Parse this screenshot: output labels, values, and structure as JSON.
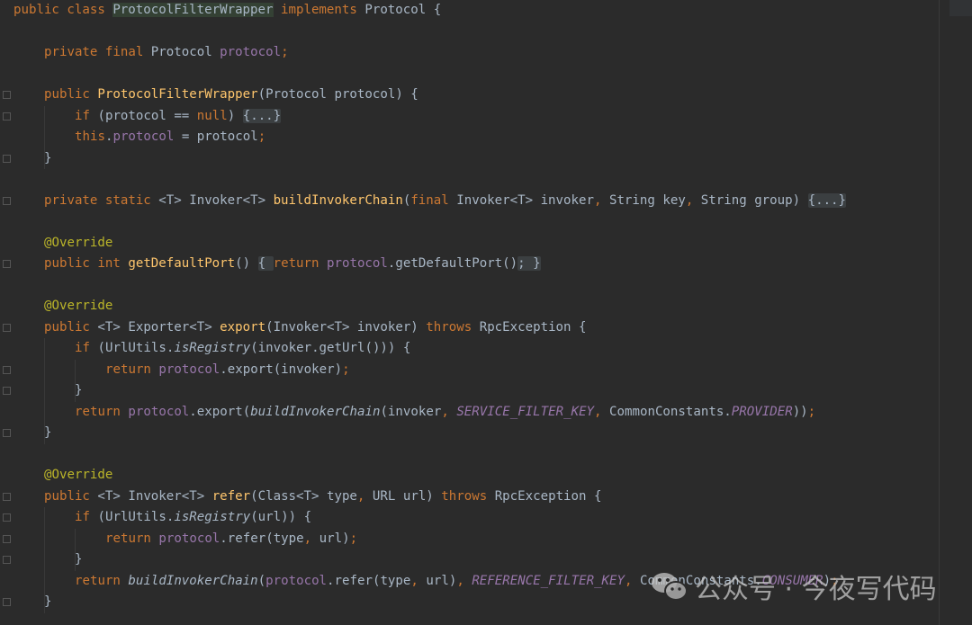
{
  "editor": {
    "lines": [
      {
        "indent": 0,
        "tokens": [
          [
            "k",
            "public class "
          ],
          [
            "hl",
            "ProtocolFilterWrapper"
          ],
          [
            "k",
            " implements "
          ],
          [
            "t",
            "Protocol {"
          ]
        ]
      },
      {
        "indent": 0,
        "tokens": []
      },
      {
        "indent": 4,
        "tokens": [
          [
            "k",
            "private final "
          ],
          [
            "t",
            "Protocol "
          ],
          [
            "f",
            "protocol"
          ],
          [
            "k",
            ";"
          ]
        ]
      },
      {
        "indent": 0,
        "tokens": []
      },
      {
        "indent": 4,
        "tokens": [
          [
            "k",
            "public "
          ],
          [
            "m",
            "ProtocolFilterWrapper"
          ],
          [
            "t",
            "(Protocol protocol) {"
          ]
        ]
      },
      {
        "indent": 8,
        "tokens": [
          [
            "k",
            "if "
          ],
          [
            "t",
            "(protocol == "
          ],
          [
            "k",
            "null"
          ],
          [
            "t",
            ") "
          ],
          [
            "fold",
            "{...}"
          ]
        ]
      },
      {
        "indent": 8,
        "tokens": [
          [
            "k",
            "this"
          ],
          [
            "t",
            "."
          ],
          [
            "f",
            "protocol"
          ],
          [
            "t",
            " = protocol"
          ],
          [
            "k",
            ";"
          ]
        ]
      },
      {
        "indent": 4,
        "tokens": [
          [
            "t",
            "}"
          ]
        ]
      },
      {
        "indent": 0,
        "tokens": []
      },
      {
        "indent": 4,
        "tokens": [
          [
            "k",
            "private static "
          ],
          [
            "t",
            "<T> Invoker<T> "
          ],
          [
            "m",
            "buildInvokerChain"
          ],
          [
            "t",
            "("
          ],
          [
            "k",
            "final "
          ],
          [
            "t",
            "Invoker<T> invoker"
          ],
          [
            "k",
            ", "
          ],
          [
            "t",
            "String key"
          ],
          [
            "k",
            ", "
          ],
          [
            "t",
            "String group) "
          ],
          [
            "fold",
            "{...}"
          ]
        ]
      },
      {
        "indent": 0,
        "tokens": []
      },
      {
        "indent": 4,
        "tokens": [
          [
            "a",
            "@Override"
          ]
        ]
      },
      {
        "indent": 4,
        "tokens": [
          [
            "k",
            "public int "
          ],
          [
            "m",
            "getDefaultPort"
          ],
          [
            "t",
            "() "
          ],
          [
            "fold",
            "{ "
          ],
          [
            "k",
            "return "
          ],
          [
            "f",
            "protocol"
          ],
          [
            "t",
            ".getDefaultPort()"
          ],
          [
            "fold",
            "; }"
          ]
        ]
      },
      {
        "indent": 0,
        "tokens": []
      },
      {
        "indent": 4,
        "tokens": [
          [
            "a",
            "@Override"
          ]
        ]
      },
      {
        "indent": 4,
        "tokens": [
          [
            "k",
            "public "
          ],
          [
            "t",
            "<T> Exporter<T> "
          ],
          [
            "m",
            "export"
          ],
          [
            "t",
            "(Invoker<T> invoker) "
          ],
          [
            "k",
            "throws "
          ],
          [
            "t",
            "RpcException {"
          ]
        ]
      },
      {
        "indent": 8,
        "tokens": [
          [
            "k",
            "if "
          ],
          [
            "t",
            "(UrlUtils."
          ],
          [
            "i",
            "isRegistry"
          ],
          [
            "t",
            "(invoker.getUrl())) {"
          ]
        ]
      },
      {
        "indent": 12,
        "tokens": [
          [
            "k",
            "return "
          ],
          [
            "f",
            "protocol"
          ],
          [
            "t",
            ".export(invoker)"
          ],
          [
            "k",
            ";"
          ]
        ]
      },
      {
        "indent": 8,
        "tokens": [
          [
            "t",
            "}"
          ]
        ]
      },
      {
        "indent": 8,
        "tokens": [
          [
            "k",
            "return "
          ],
          [
            "f",
            "protocol"
          ],
          [
            "t",
            ".export("
          ],
          [
            "i",
            "buildInvokerChain"
          ],
          [
            "t",
            "(invoker"
          ],
          [
            "k",
            ", "
          ],
          [
            "c",
            "SERVICE_FILTER_KEY"
          ],
          [
            "k",
            ", "
          ],
          [
            "t",
            "CommonConstants."
          ],
          [
            "c",
            "PROVIDER"
          ],
          [
            "t",
            "))"
          ],
          [
            "k",
            ";"
          ]
        ]
      },
      {
        "indent": 4,
        "tokens": [
          [
            "t",
            "}"
          ]
        ]
      },
      {
        "indent": 0,
        "tokens": []
      },
      {
        "indent": 4,
        "tokens": [
          [
            "a",
            "@Override"
          ]
        ]
      },
      {
        "indent": 4,
        "tokens": [
          [
            "k",
            "public "
          ],
          [
            "t",
            "<T> Invoker<T> "
          ],
          [
            "m",
            "refer"
          ],
          [
            "t",
            "(Class<T> type"
          ],
          [
            "k",
            ", "
          ],
          [
            "t",
            "URL url) "
          ],
          [
            "k",
            "throws "
          ],
          [
            "t",
            "RpcException {"
          ]
        ]
      },
      {
        "indent": 8,
        "tokens": [
          [
            "k",
            "if "
          ],
          [
            "t",
            "(UrlUtils."
          ],
          [
            "i",
            "isRegistry"
          ],
          [
            "t",
            "(url)) {"
          ]
        ]
      },
      {
        "indent": 12,
        "tokens": [
          [
            "k",
            "return "
          ],
          [
            "f",
            "protocol"
          ],
          [
            "t",
            ".refer(type"
          ],
          [
            "k",
            ", "
          ],
          [
            "t",
            "url)"
          ],
          [
            "k",
            ";"
          ]
        ]
      },
      {
        "indent": 8,
        "tokens": [
          [
            "t",
            "}"
          ]
        ]
      },
      {
        "indent": 8,
        "tokens": [
          [
            "k",
            "return "
          ],
          [
            "i",
            "buildInvokerChain"
          ],
          [
            "t",
            "("
          ],
          [
            "f",
            "protocol"
          ],
          [
            "t",
            ".refer(type"
          ],
          [
            "k",
            ", "
          ],
          [
            "t",
            "url)"
          ],
          [
            "k",
            ", "
          ],
          [
            "c",
            "REFERENCE_FILTER_KEY"
          ],
          [
            "k",
            ", "
          ],
          [
            "t",
            "CommonConstants."
          ],
          [
            "c",
            "CONSUMER"
          ],
          [
            "t",
            ")"
          ],
          [
            "k",
            ";"
          ]
        ]
      },
      {
        "indent": 4,
        "tokens": [
          [
            "t",
            "}"
          ]
        ]
      }
    ]
  },
  "watermark": {
    "icon": "wechat-icon",
    "text": "公众号 · 今夜写代码"
  },
  "colors": {
    "background": "#2b2b2b",
    "keyword": "#cc7832",
    "field": "#9876aa",
    "method": "#ffc66d",
    "annotation": "#bbb529",
    "text": "#a9b7c6"
  }
}
